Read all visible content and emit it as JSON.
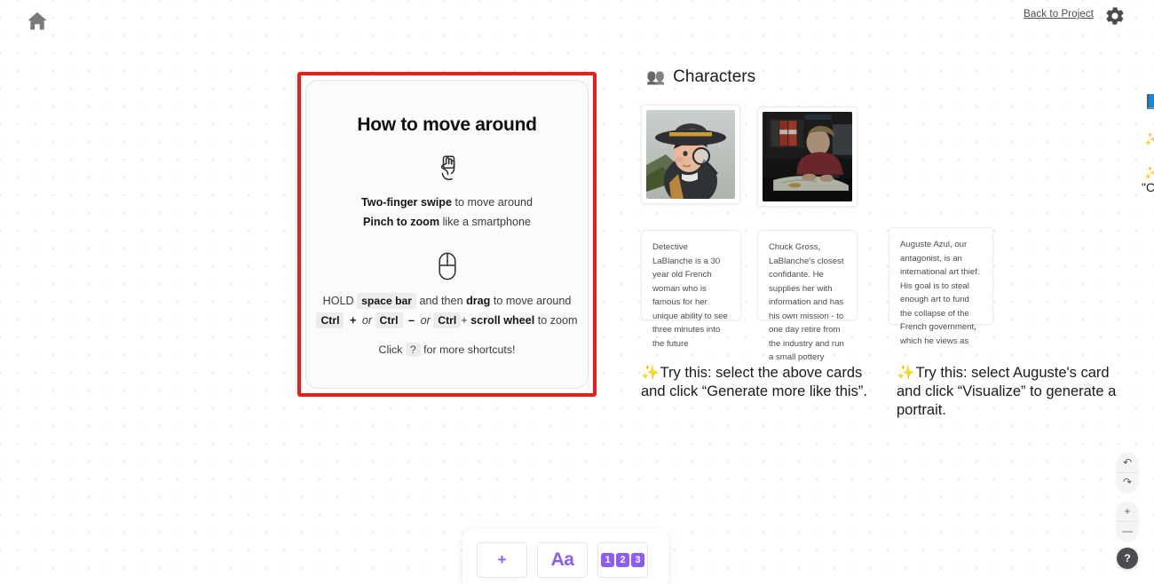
{
  "topbar": {
    "home_icon": "home-icon",
    "back_link": "Back to Project",
    "gear_icon": "gear-icon"
  },
  "howto_card": {
    "title": "How to move around",
    "trackpad_icon": "two-finger-swipe-icon",
    "mouse_icon": "mouse-icon",
    "line1_bold": "Two-finger swipe",
    "line1_rest": " to move around",
    "line2_bold": "Pinch to zoom",
    "line2_rest": " like a smartphone",
    "line3_pre": "HOLD ",
    "line3_key": "space bar",
    "line3_mid": " and then ",
    "line3_bold": "drag",
    "line3_post": " to move around",
    "line4_key1": "Ctrl",
    "line4_plus": "+",
    "line4_or1": "or",
    "line4_key2": "Ctrl",
    "line4_minus": "–",
    "line4_or2": "or",
    "line4_key3": "Ctrl",
    "line4_scroll_pre": "+ ",
    "line4_scroll_bold": "scroll wheel",
    "line4_scroll_post": " to zoom",
    "footer_pre": "Click ",
    "footer_key": "?",
    "footer_post": " for more shortcuts!",
    "selection_color": "#f01c1c"
  },
  "characters": {
    "heading_emoji": "👥",
    "heading": "Characters",
    "cards": [
      {
        "text": "Detective LaBlanche is a 30 year old French woman who is famous for her unique ability to see three minutes into the future"
      },
      {
        "text": "Chuck Gross, LaBlanche's closest confidante. He supplies her with information and has his own mission - to one day retire from the industry and run a small pottery"
      },
      {
        "text": "Auguste Azul, our antagonist, is an international art thief. His goal is to steal enough art to fund the collapse of the French government, which he views as"
      }
    ],
    "image_alt_1": "detective-woman-portrait",
    "image_alt_2": "man-at-desk-photo"
  },
  "try_notes": [
    {
      "emoji": "✨",
      "text": "Try this: select the above cards and click “Generate more like this”."
    },
    {
      "emoji": "✨",
      "text": "Try this: select Auguste's card and click “Visualize” to generate a portrait."
    }
  ],
  "edge_items": {
    "doc_emoji": "📘",
    "spark_1": "✨",
    "spark_2": "✨",
    "quote_fragment": "\"C"
  },
  "toolbar": {
    "add_label": "+",
    "text_label": "Aa",
    "number_chips": [
      "1",
      "2",
      "3"
    ],
    "accent": "#8b5cf6"
  },
  "canvas_controls": {
    "undo": "↶",
    "redo": "↷",
    "zoom_in": "+",
    "zoom_out": "—",
    "help": "?"
  }
}
